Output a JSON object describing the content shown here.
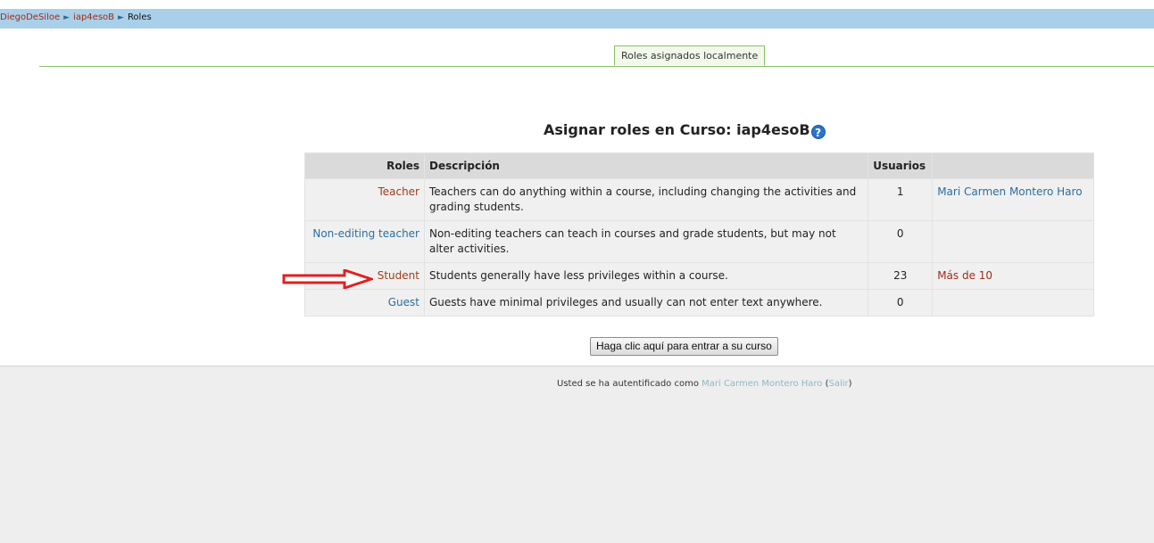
{
  "breadcrumb": {
    "items": [
      "DiegoDeSiloe",
      "iap4esoB",
      "Roles"
    ],
    "separator": "►"
  },
  "tabs": {
    "active_label": "Roles asignados localmente"
  },
  "page": {
    "heading": "Asignar roles en Curso: iap4esoB",
    "help_icon": "question-circle-icon"
  },
  "table": {
    "headers": {
      "roles": "Roles",
      "description": "Descripción",
      "users": "Usuarios",
      "members": ""
    },
    "rows": [
      {
        "role": "Teacher",
        "description": "Teachers can do anything within a course, including changing the activities and grading students.",
        "users": "1",
        "members": "Mari Carmen Montero Haro"
      },
      {
        "role": "Non-editing teacher",
        "description": "Non-editing teachers can teach in courses and grade students, but may not alter activities.",
        "users": "0",
        "members": ""
      },
      {
        "role": "Student",
        "description": "Students generally have less privileges within a course.",
        "users": "23",
        "members": "Más de 10"
      },
      {
        "role": "Guest",
        "description": "Guests have minimal privileges and usually can not enter text anywhere.",
        "users": "0",
        "members": ""
      }
    ]
  },
  "enter_button": {
    "label": "Haga clic aquí para entrar a su curso"
  },
  "footer": {
    "logged_in_prefix": "Usted se ha autentificado como ",
    "user_name": "Mari Carmen Montero Haro",
    "open_paren": " (",
    "logout_label": "Salir",
    "close_paren": ")"
  },
  "colors": {
    "navbar": "#a9cfe9",
    "tab_border": "#87c06c",
    "link_red": "#9e2a18",
    "link_blue": "#2c6ea0",
    "annotation_arrow": "#e02020"
  }
}
